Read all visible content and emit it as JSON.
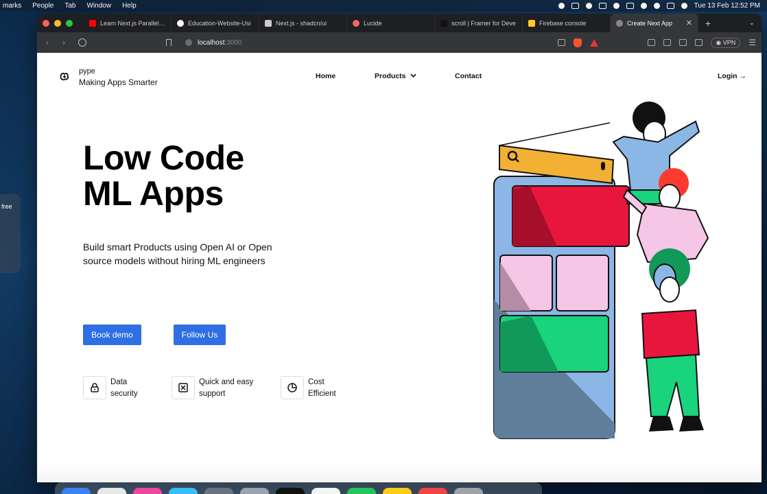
{
  "menubar": {
    "items": [
      "marks",
      "People",
      "Tab",
      "Window",
      "Help"
    ],
    "datetime": "Tue 13 Feb  12:52 PM"
  },
  "side_widget": {
    "text": "free"
  },
  "browser": {
    "tabs": [
      {
        "label": "Learn Next.js Parallel Ro",
        "favicon_color": "#ff0000"
      },
      {
        "label": "Education-Website-Usi",
        "favicon_color": "#ffffff"
      },
      {
        "label": "Next.js - shadcn/ui",
        "favicon_color": "#cccccc"
      },
      {
        "label": "Lucide",
        "favicon_color": "#f56565"
      },
      {
        "label": "scroll | Framer for Deve",
        "favicon_color": "#111111"
      },
      {
        "label": "Firebase console",
        "favicon_color": "#ffca28"
      },
      {
        "label": "Create Next App",
        "favicon_color": "#888888",
        "active": true
      }
    ],
    "new_tab": "+",
    "address": {
      "host": "localhost",
      "port": ":3000"
    },
    "vpn_label": "VPN"
  },
  "site": {
    "brand": {
      "name": "pype",
      "tagline": "Making Apps Smarter"
    },
    "nav": {
      "home": "Home",
      "products": "Products",
      "contact": "Contact",
      "login": "Login →"
    },
    "hero": {
      "title_line1": "Low Code",
      "title_line2": "ML Apps",
      "subtitle": "Build smart Products using Open AI or Open source models without hiring ML engineers"
    },
    "buttons": {
      "demo": "Book demo",
      "follow": "Follow Us"
    },
    "features": [
      {
        "label": "Data security",
        "icon": "lock-icon"
      },
      {
        "label": "Quick and easy support",
        "icon": "close-square-icon"
      },
      {
        "label": "Cost Efficient",
        "icon": "pie-chart-icon"
      }
    ],
    "colors": {
      "accent": "#2f6fe4"
    }
  }
}
